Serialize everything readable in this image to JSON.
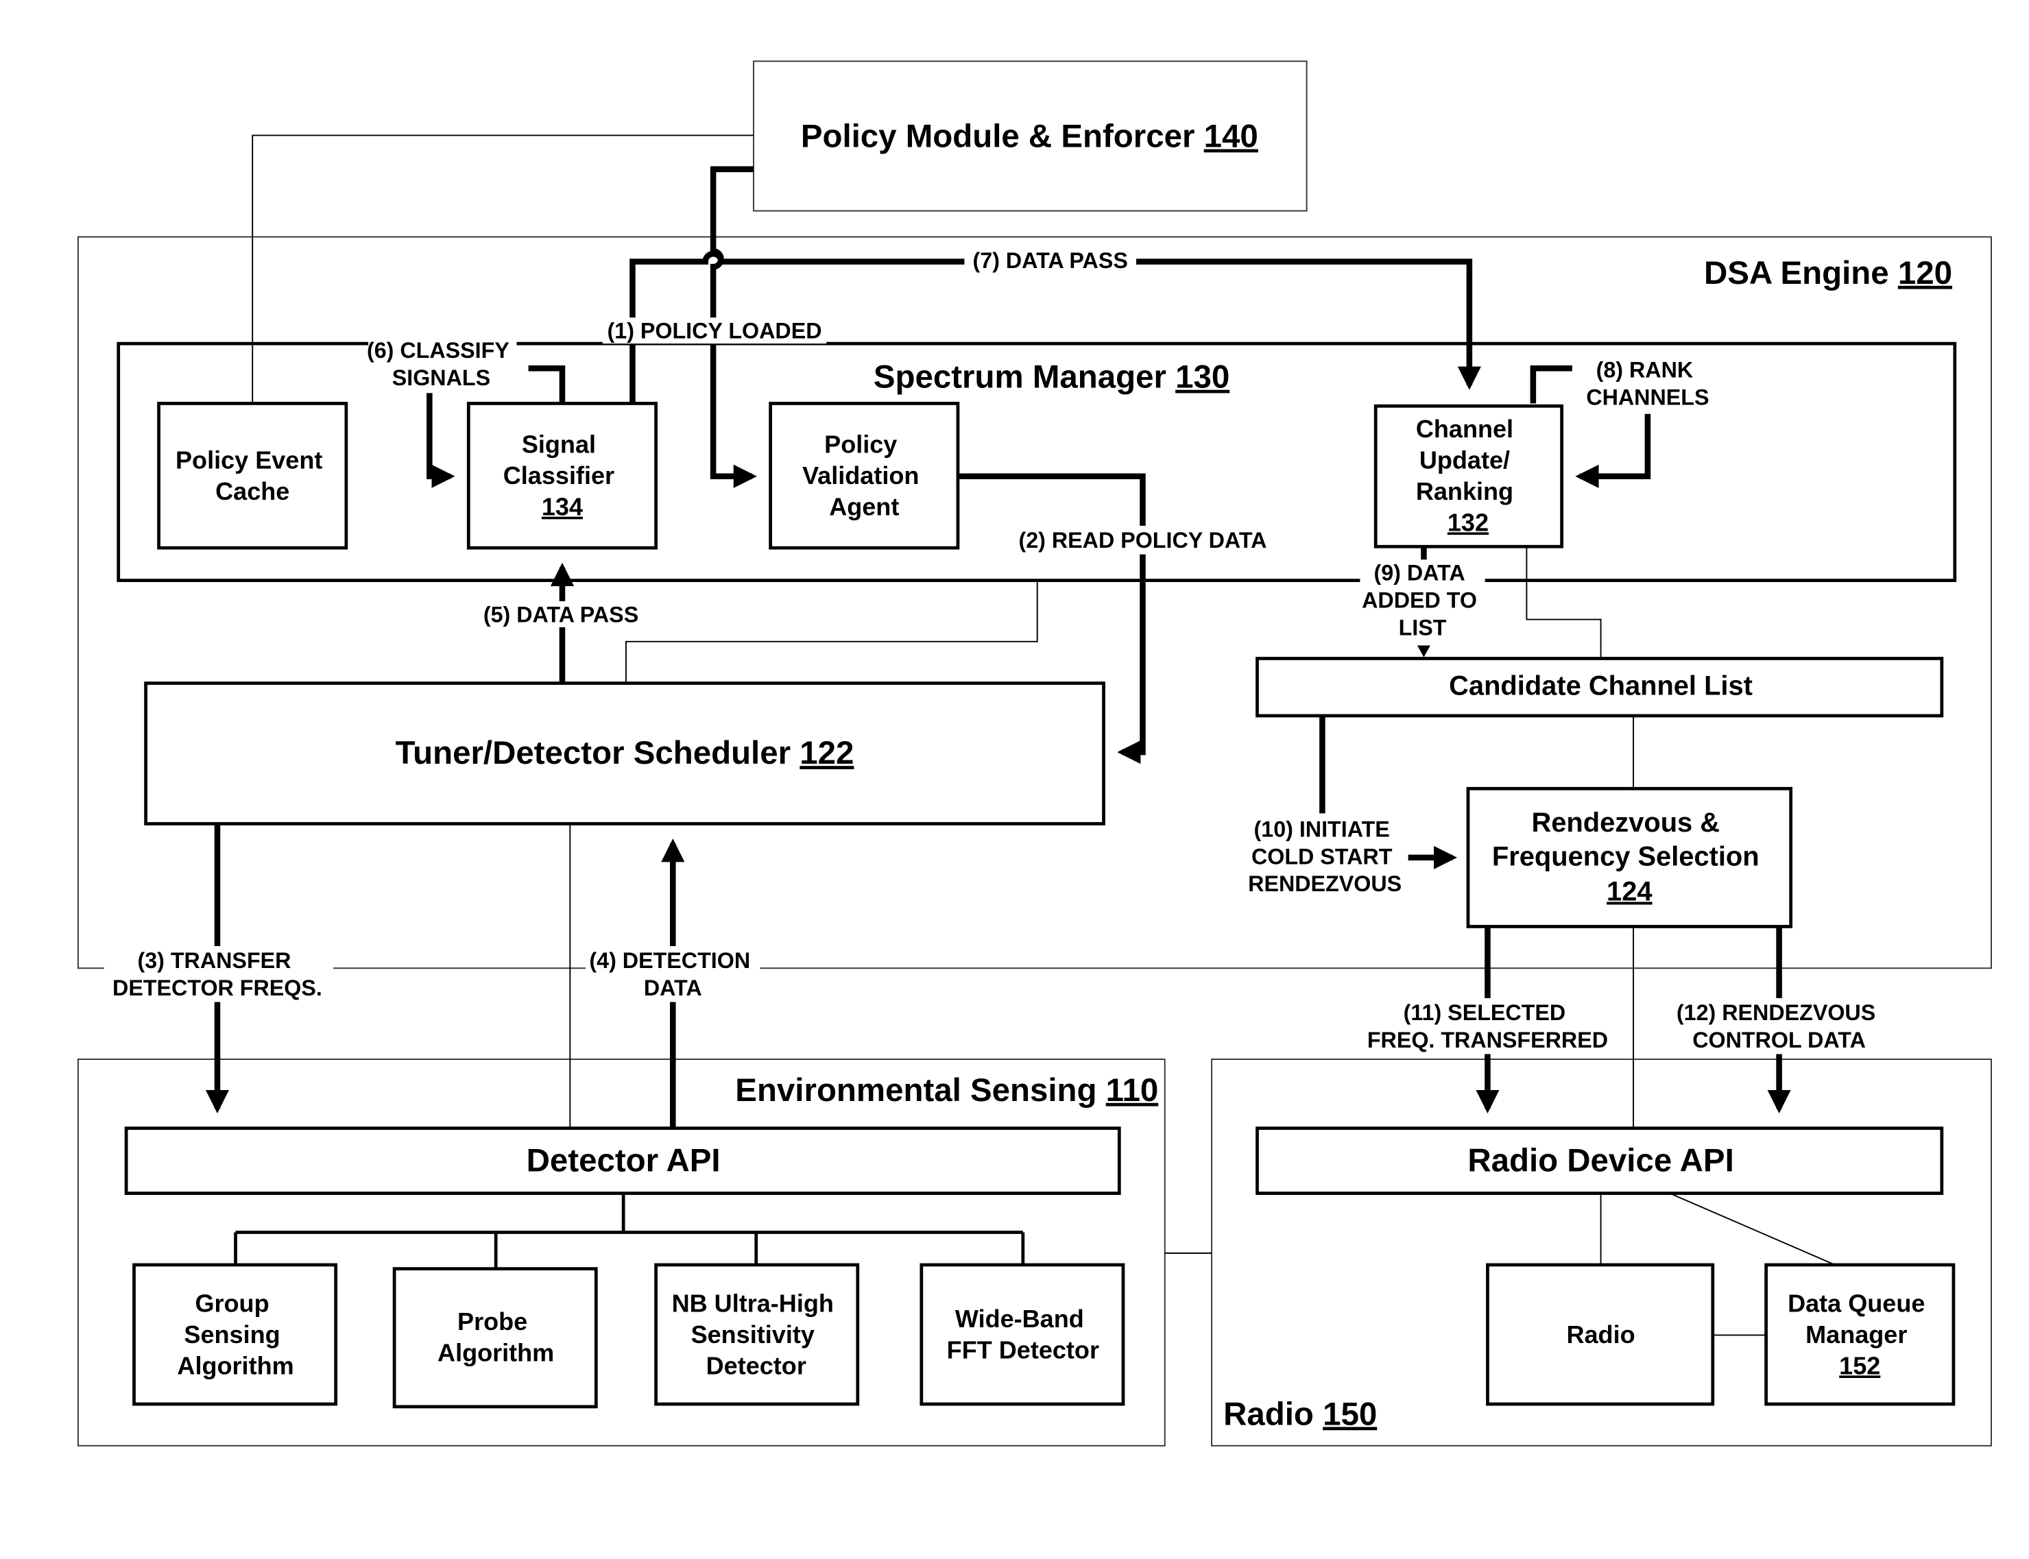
{
  "colors": {
    "ink": "#000000",
    "background": "#ffffff"
  },
  "containers": {
    "policy_module": {
      "label": "Policy Module & Enforcer",
      "ref": "140"
    },
    "dsa_engine": {
      "label": "DSA Engine",
      "ref": "120"
    },
    "spectrum_manager": {
      "label": "Spectrum Manager",
      "ref": "130"
    },
    "environmental_sensing": {
      "label": "Environmental Sensing",
      "ref": "110"
    },
    "radio": {
      "label": "Radio",
      "ref": "150"
    }
  },
  "boxes": {
    "policy_event_cache": {
      "lines": [
        "Policy Event",
        "Cache"
      ]
    },
    "signal_classifier": {
      "lines": [
        "Signal",
        "Classifier"
      ],
      "ref": "134"
    },
    "policy_validation_agent": {
      "lines": [
        "Policy",
        "Validation",
        "Agent"
      ]
    },
    "channel_update_ranking": {
      "lines": [
        "Channel",
        "Update/",
        "Ranking"
      ],
      "ref": "132"
    },
    "tuner_detector_scheduler": {
      "label": "Tuner/Detector Scheduler",
      "ref": "122"
    },
    "candidate_channel_list": {
      "label": "Candidate Channel List"
    },
    "rendezvous_freq_selection": {
      "lines": [
        "Rendezvous &",
        "Frequency Selection"
      ],
      "ref": "124"
    },
    "detector_api": {
      "label": "Detector API"
    },
    "group_sensing": {
      "lines": [
        "Group",
        "Sensing",
        "Algorithm"
      ]
    },
    "probe_algorithm": {
      "lines": [
        "Probe",
        "Algorithm"
      ]
    },
    "nb_ultra_high": {
      "lines": [
        "NB Ultra-High",
        "Sensitivity",
        "Detector"
      ]
    },
    "wide_band_fft": {
      "lines": [
        "Wide-Band",
        "FFT Detector"
      ]
    },
    "radio_device_api": {
      "label": "Radio Device API"
    },
    "radio_box": {
      "label": "Radio"
    },
    "data_queue_manager": {
      "lines": [
        "Data Queue",
        "Manager"
      ],
      "ref": "152"
    }
  },
  "flows": {
    "f1": [
      "(1) POLICY LOADED"
    ],
    "f2": [
      "(2) READ POLICY DATA"
    ],
    "f3": [
      "(3) TRANSFER",
      "DETECTOR FREQS."
    ],
    "f4": [
      "(4) DETECTION",
      "DATA"
    ],
    "f5": [
      "(5) DATA PASS"
    ],
    "f6": [
      "(6) CLASSIFY",
      "SIGNALS"
    ],
    "f7": [
      "(7) DATA PASS"
    ],
    "f8": [
      "(8) RANK",
      "CHANNELS"
    ],
    "f9": [
      "(9) DATA",
      "ADDED TO",
      "LIST"
    ],
    "f10": [
      "(10) INITIATE",
      "COLD START",
      "RENDEZVOUS"
    ],
    "f11": [
      "(11) SELECTED",
      "FREQ. TRANSFERRED"
    ],
    "f12": [
      "(12) RENDEZVOUS",
      "CONTROL DATA"
    ]
  }
}
